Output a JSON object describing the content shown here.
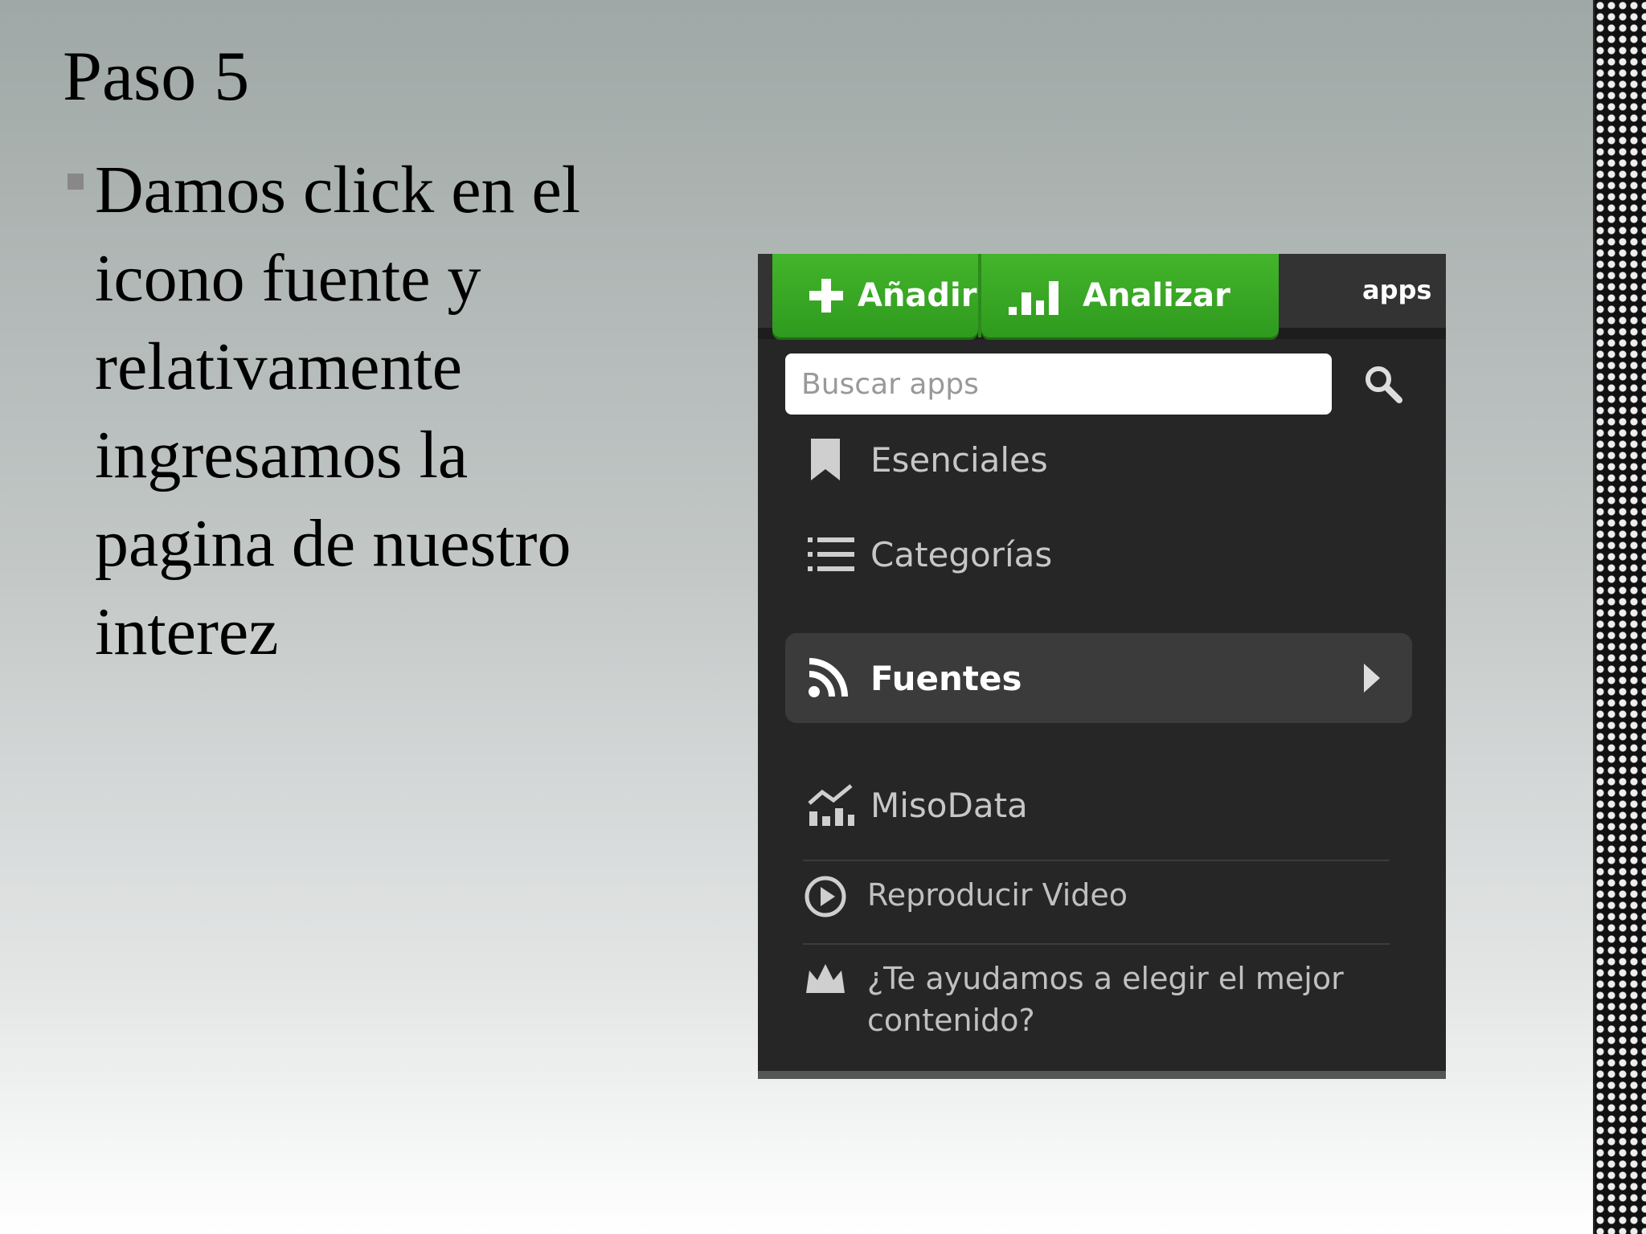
{
  "slide": {
    "title": "Paso 5",
    "bullet": "Damos click en el icono fuente y relativamente ingresamos la pagina de nuestro interez"
  },
  "app": {
    "toolbar": {
      "add_label": "Añadir",
      "analyze_label": "Analizar",
      "apps_label": "apps"
    },
    "search": {
      "placeholder": "Buscar apps",
      "value": ""
    },
    "nav": {
      "items": [
        {
          "label": "Esenciales",
          "icon": "bookmark-icon"
        },
        {
          "label": "Categorías",
          "icon": "list-icon"
        },
        {
          "label": "Fuentes",
          "icon": "rss-icon",
          "selected": true
        },
        {
          "label": "MisoData",
          "icon": "chart-icon"
        }
      ]
    },
    "footer": {
      "video_label": "Reproducir Video",
      "help_label": "¿Te ayudamos a elegir el mejor contenido?"
    },
    "colors": {
      "accent_green": "#3aa826",
      "panel_bg": "#262626",
      "selected_bg": "#3b3b3b"
    }
  }
}
